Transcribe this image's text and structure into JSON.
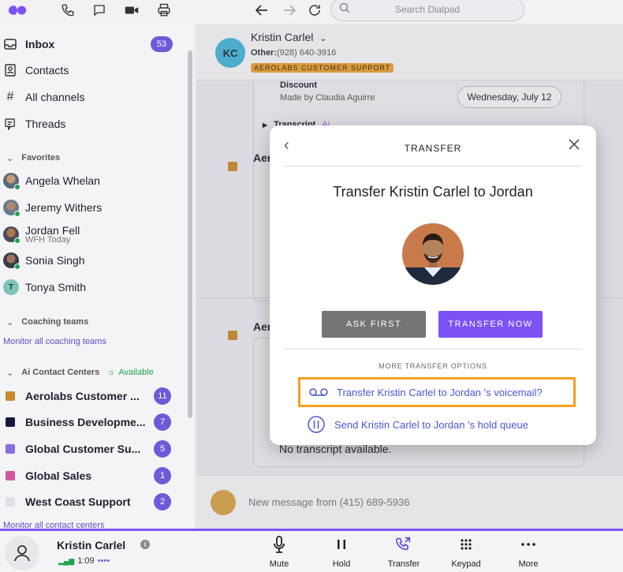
{
  "topbar": {
    "search_placeholder": "Search Dialpad",
    "icons": [
      "dialpad-logo",
      "phone-icon",
      "chat-icon",
      "video-icon",
      "printer-icon",
      "back-arrow-icon",
      "forward-arrow-icon",
      "refresh-icon",
      "search-icon"
    ]
  },
  "sidebar": {
    "nav": [
      {
        "label": "Inbox",
        "badge": "53"
      },
      {
        "label": "Contacts"
      },
      {
        "label": "All channels"
      },
      {
        "label": "Threads"
      }
    ],
    "favorites_heading": "Favorites",
    "favorites": [
      {
        "name": "Angela Whelan",
        "status": ""
      },
      {
        "name": "Jeremy Withers",
        "status": ""
      },
      {
        "name": "Jordan Fell",
        "status": "WFH Today"
      },
      {
        "name": "Sonia Singh",
        "status": ""
      },
      {
        "name": "Tonya Smith",
        "status": "",
        "initial": "T"
      }
    ],
    "coaching_heading": "Coaching teams",
    "coaching_link": "Monitor all coaching teams",
    "centers_heading": "Ai Contact Centers",
    "centers_status": "Available",
    "centers": [
      {
        "name": "Aerolabs Customer ...",
        "count": "11",
        "color": "#c88a2e"
      },
      {
        "name": "Business Developme...",
        "count": "7",
        "color": "#161a3a"
      },
      {
        "name": "Global Customer Su...",
        "count": "5",
        "color": "#8b6ee0"
      },
      {
        "name": "Global Sales",
        "count": "1",
        "color": "#d25a9e"
      },
      {
        "name": "West Coast Support",
        "count": "2",
        "color": "#e0e0ea"
      }
    ],
    "centers_link": "Monitor all contact centers"
  },
  "conversation": {
    "initials": "KC",
    "name": "Kristin Carlel",
    "phone_label": "Other:",
    "phone": "(928) 640-3916",
    "tag": "AEROLABS CUSTOMER SUPPORT",
    "discount_title": "Discount",
    "discount_sub": "Made by Claudia Aguirre",
    "date_pill": "Wednesday, July 12",
    "transcript_label": "Transcript",
    "ai_label": "Ai",
    "aer_label": "Aer",
    "no_transcript": "No transcript available.",
    "new_message": "New message from (415) 689-5936"
  },
  "modal": {
    "title": "TRANSFER",
    "heading": "Transfer Kristin Carlel to Jordan",
    "ask_first": "ASK FIRST",
    "transfer_now": "TRANSFER NOW",
    "more_options": "MORE TRANSFER OPTIONS",
    "voicemail_option": "Transfer Kristin Carlel to Jordan 's voicemail?",
    "hold_option": "Send Kristin Carlel to Jordan 's hold queue"
  },
  "callbar": {
    "name": "Kristin Carlel",
    "duration": "1:09",
    "controls": [
      "Mute",
      "Hold",
      "Transfer",
      "Keypad",
      "More"
    ]
  },
  "colors": {
    "accent": "#7c52f5",
    "badge": "#6c5bd8",
    "highlight": "#f4a11d",
    "tag": "#e8a135"
  }
}
